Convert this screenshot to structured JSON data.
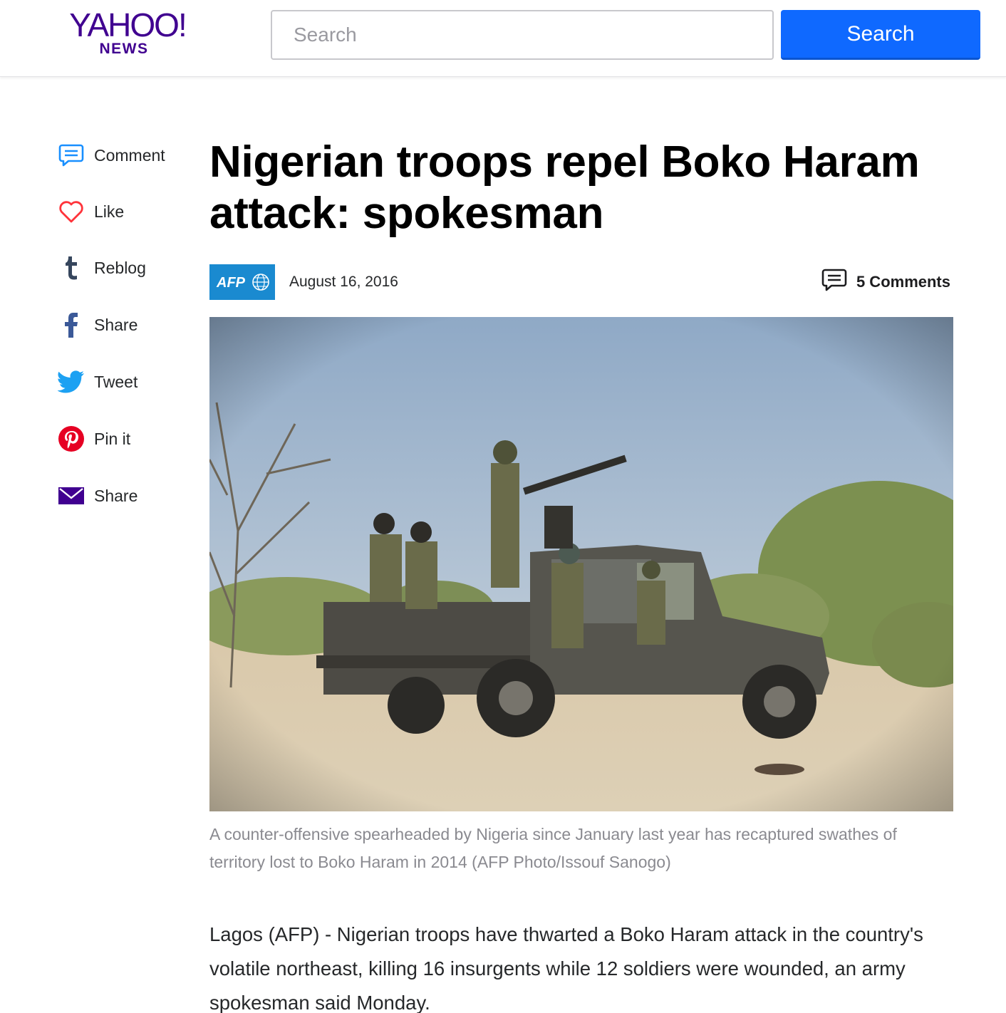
{
  "header": {
    "logo_text": "YAHOO!",
    "logo_sub": "NEWS",
    "search_placeholder": "Search",
    "search_button": "Search",
    "brand_color": "#400090",
    "accent_color": "#0f69ff"
  },
  "share_rail": {
    "items": [
      {
        "label": "Comment",
        "icon": "comment-icon"
      },
      {
        "label": "Like",
        "icon": "heart-icon"
      },
      {
        "label": "Reblog",
        "icon": "tumblr-icon"
      },
      {
        "label": "Share",
        "icon": "facebook-icon"
      },
      {
        "label": "Tweet",
        "icon": "twitter-icon"
      },
      {
        "label": "Pin it",
        "icon": "pinterest-icon"
      },
      {
        "label": "Share",
        "icon": "mail-icon"
      }
    ]
  },
  "article": {
    "title": "Nigerian troops repel Boko Haram attack: spokesman",
    "source_logo": "AFP",
    "date": "August 16, 2016",
    "comments_label": "5 Comments",
    "image_caption": "A counter-offensive spearheaded by Nigeria since January last year has recaptured swathes of territory lost to Boko Haram in 2014 (AFP Photo/Issouf Sanogo)",
    "body_first_paragraph": "Lagos (AFP) - Nigerian troops have thwarted a Boko Haram attack in the country's volatile northeast, killing 16 insurgents while 12 soldiers were wounded, an army spokesman said Monday."
  }
}
